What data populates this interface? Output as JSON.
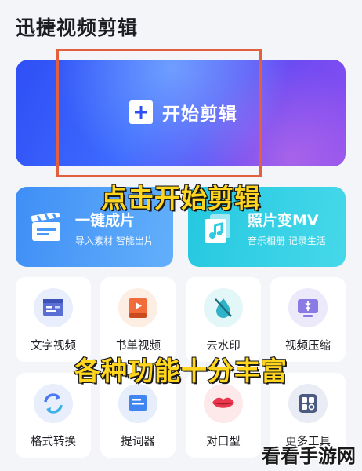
{
  "app": {
    "title": "迅捷视频剪辑"
  },
  "hero": {
    "start_label": "开始剪辑",
    "accent": "#3d6bff"
  },
  "cards": [
    {
      "title": "一键成片",
      "subtitle": "导入素材 智能出片",
      "icon": "clapperboard-icon"
    },
    {
      "title": "照片变MV",
      "subtitle": "音乐相册 记录生活",
      "icon": "photo-music-icon"
    }
  ],
  "tools": [
    {
      "label": "文字视频",
      "icon": "text-video-icon"
    },
    {
      "label": "书单视频",
      "icon": "book-video-icon"
    },
    {
      "label": "去水印",
      "icon": "watermark-remove-icon"
    },
    {
      "label": "视频压缩",
      "icon": "video-compress-icon"
    },
    {
      "label": "格式转换",
      "icon": "format-convert-icon"
    },
    {
      "label": "提词器",
      "icon": "teleprompter-icon"
    },
    {
      "label": "对口型",
      "icon": "lip-sync-icon"
    },
    {
      "label": "更多工具",
      "icon": "more-tools-icon"
    }
  ],
  "annotations": {
    "top": "点击开始剪辑",
    "bottom": "各种功能十分丰富"
  },
  "watermark": "看看手游网",
  "colors": {
    "highlight_border": "#e2603e",
    "caption_text": "#ffd51e"
  }
}
